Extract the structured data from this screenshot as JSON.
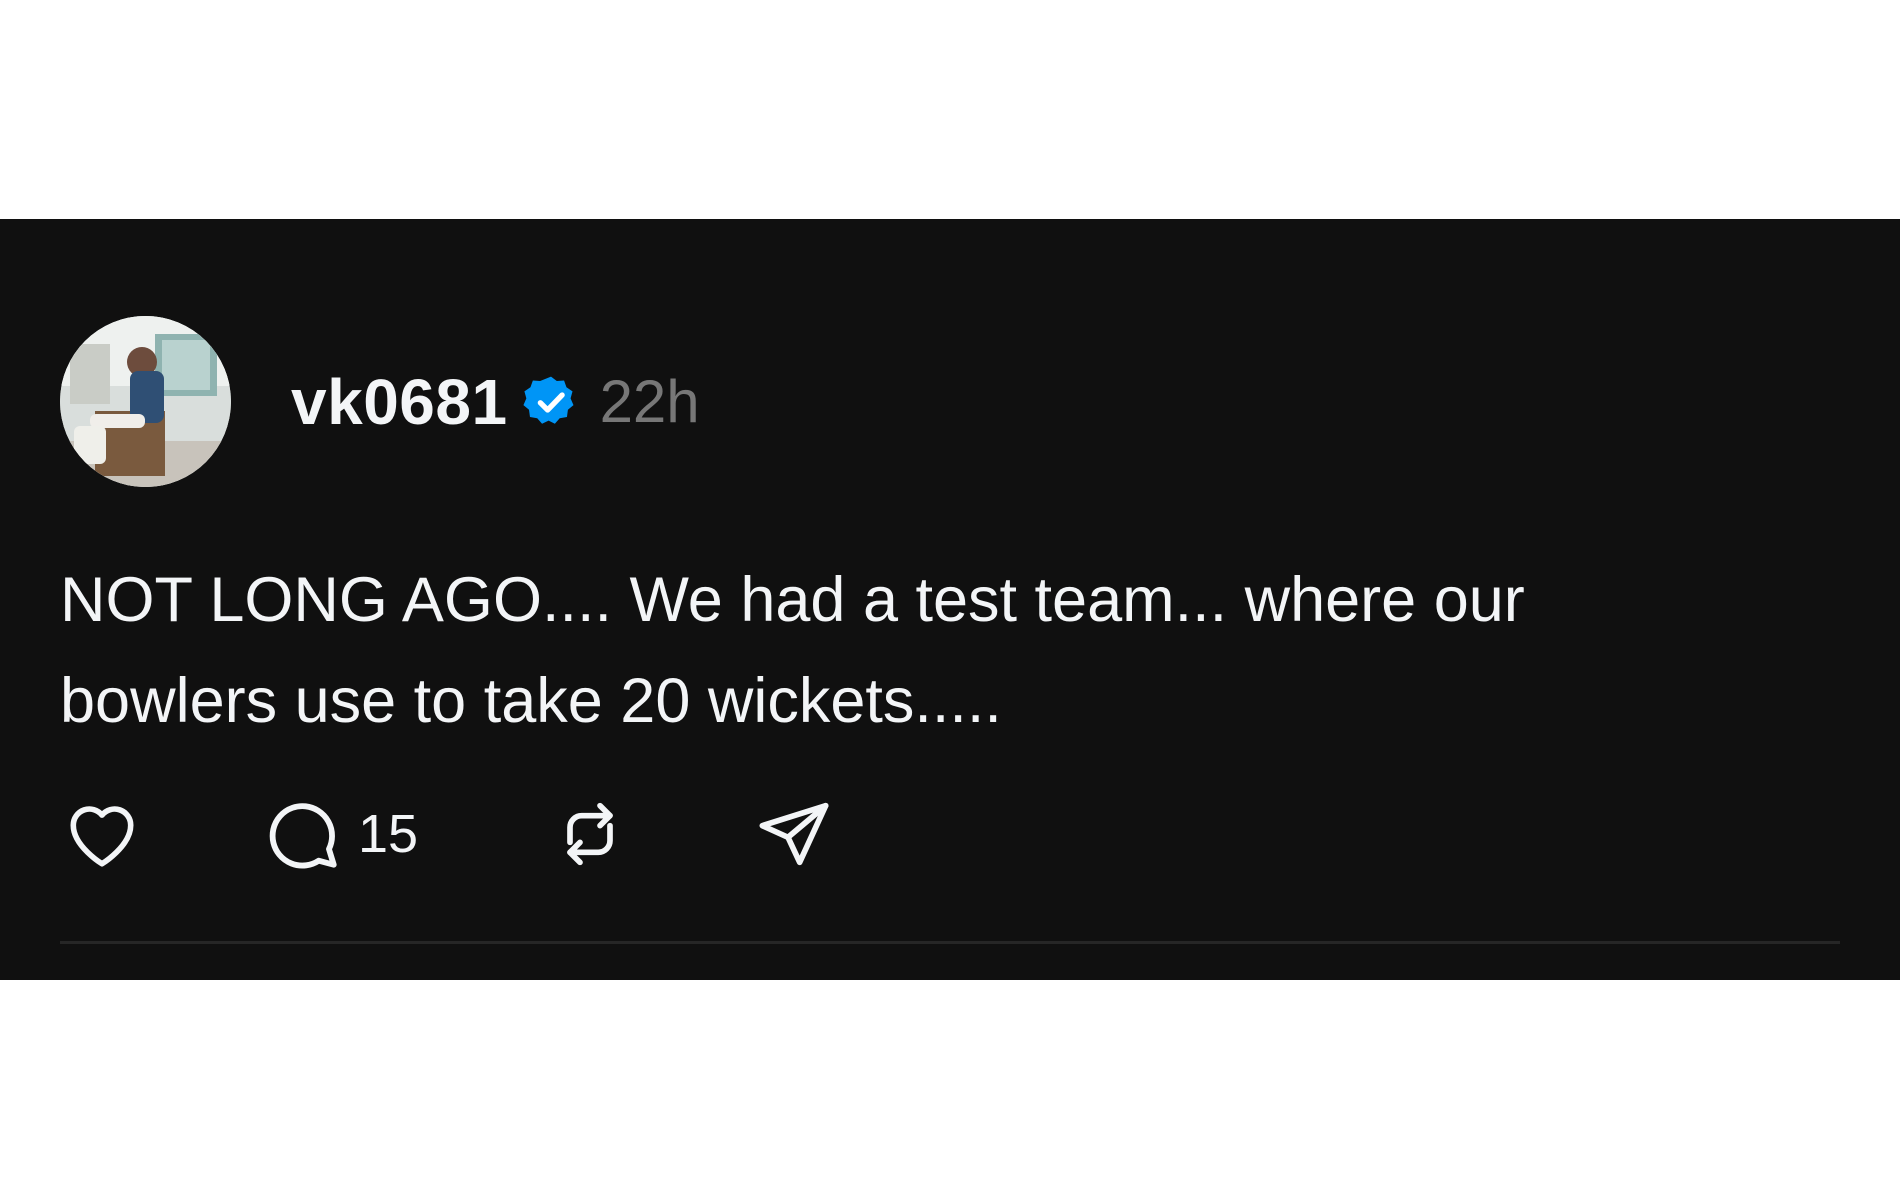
{
  "post": {
    "username": "vk0681",
    "verified_icon": "verified-badge-icon",
    "timestamp": "22h",
    "text": "NOT LONG AGO.... We had a test team... where our\nbowlers use to take 20 wickets.....",
    "actions": {
      "like_icon": "heart-icon",
      "reply_icon": "speech-bubble-icon",
      "reply_count": "15",
      "repost_icon": "repost-arrows-icon",
      "share_icon": "paper-plane-icon"
    }
  },
  "colors": {
    "background": "#101010",
    "text": "#f3f5f7",
    "muted": "#777777",
    "verified": "#0095f6",
    "divider": "#262626"
  }
}
